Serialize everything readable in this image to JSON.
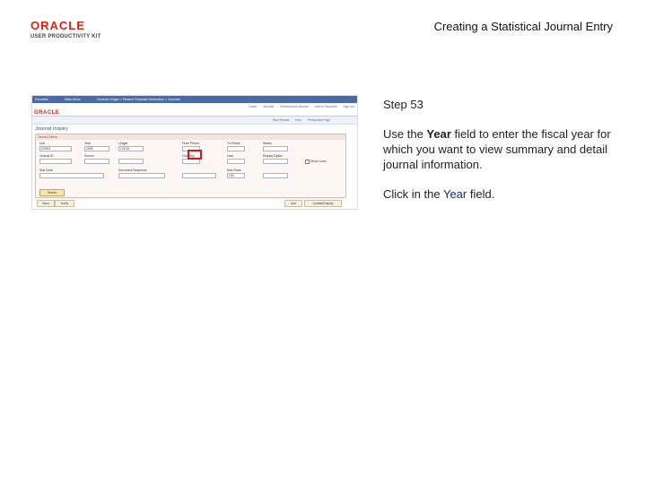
{
  "header": {
    "logo_text": "ORACLE",
    "logo_subtext": "USER PRODUCTIVITY KIT",
    "title": "Creating a Statistical Journal Entry"
  },
  "instructions": {
    "step": "Step 53",
    "para1_pre": "Use the ",
    "para1_bold": "Year",
    "para1_post": " field to enter the fiscal year for which you want to view summary and detail journal information.",
    "para2_pre": "Click in the ",
    "para2_kw": "Year",
    "para2_post": " field."
  },
  "screenshot": {
    "nav_items": [
      "Favorites",
      "Main Menu",
      "General Ledger > Review Financial Information > Journals"
    ],
    "top_links": [
      "Home",
      "Worklist",
      "Performance Monitor",
      "Add to Favorites",
      "Sign out"
    ],
    "logo_text": "ORACLE",
    "crumb_links": [
      "New Window",
      "Help",
      "Personalize Page"
    ],
    "page_title": "Journal Inquiry",
    "panel_title": "Journal Criteria",
    "labels": {
      "unit": "Unit",
      "year": "Year",
      "ledger": "Ledger",
      "from_period": "From Period",
      "to_period": "To Period",
      "source": "Source",
      "journal_id": "Journal ID",
      "status": "Status",
      "currency": "Currency",
      "user": "User",
      "document_sequence": "Document Sequence",
      "stat_code": "Stat Code",
      "max_rows": "Max Rows",
      "display_option": "Display Option",
      "show_lines": "Show Lines"
    },
    "values": {
      "unit": "US001",
      "year": "2005",
      "ledger": "LOCAL",
      "max_rows": "100",
      "stat_code": ""
    },
    "search_button": "Search",
    "footer_left": [
      "Save",
      "Notify"
    ],
    "footer_right": [
      "Add",
      "Update/Display"
    ]
  }
}
